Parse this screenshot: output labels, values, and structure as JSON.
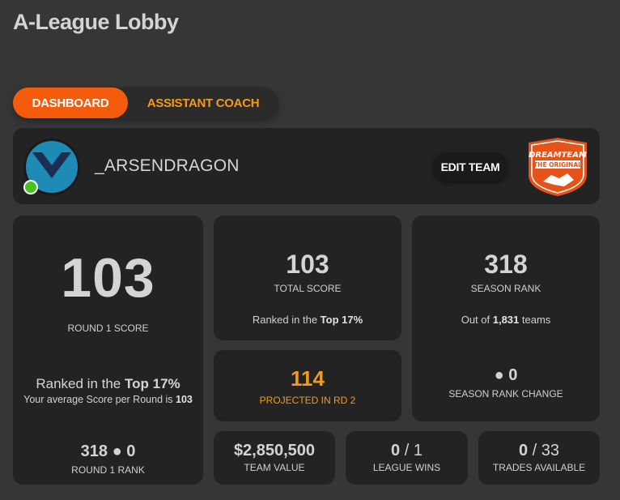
{
  "page_title": "A-League Lobby",
  "tabs": [
    {
      "label": "DASHBOARD",
      "active": true
    },
    {
      "label": "ASSISTANT COACH",
      "active": false
    }
  ],
  "team": {
    "name": "_ARSENDRAGON",
    "edit_label": "EDIT TEAM",
    "online": true,
    "logo_text_1": "DREAMTEAM",
    "logo_text_2": "THE ORIGINAL"
  },
  "round_score": {
    "value": "103",
    "label": "ROUND 1 SCORE",
    "ranked_prefix": "Ranked in the ",
    "ranked_value": "Top 17%",
    "avg_prefix": "Your average Score per Round is ",
    "avg_value": "103"
  },
  "round_rank": {
    "value": "318",
    "dot": "●",
    "change": "0",
    "label": "ROUND 1 RANK"
  },
  "total_score": {
    "value": "103",
    "label": "TOTAL SCORE",
    "ranked_prefix": "Ranked in the ",
    "ranked_value": "Top 17%"
  },
  "season_rank": {
    "value": "318",
    "label": "SEASON RANK",
    "out_of_prefix": "Out of ",
    "out_of_value": "1,831",
    "out_of_suffix": " teams"
  },
  "projected": {
    "value": "114",
    "label": "PROJECTED IN RD 2"
  },
  "season_rank_change": {
    "dot": "●",
    "value": "0",
    "label": "SEASON RANK CHANGE"
  },
  "team_value": {
    "value": "$2,850,500",
    "label": "TEAM VALUE"
  },
  "league_wins": {
    "value": "0",
    "total": " / 1",
    "label": "LEAGUE WINS"
  },
  "trades": {
    "value": "0",
    "total": " / 33",
    "label": "TRADES AVAILABLE"
  },
  "colors": {
    "accent": "#f45b0b",
    "accent_text": "#f39a1c",
    "online": "#4cc21e",
    "avatar": "#1d8bb5"
  }
}
